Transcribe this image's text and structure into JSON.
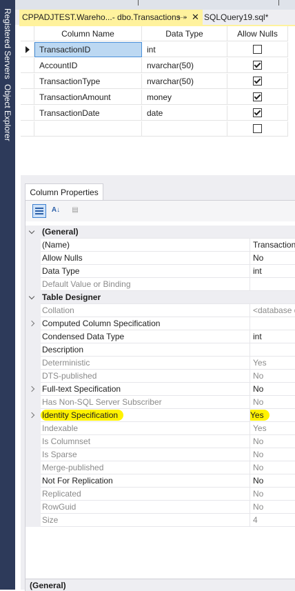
{
  "sidebar": {
    "registered_servers": "Registered Servers",
    "object_explorer": "Object Explorer"
  },
  "tabs": {
    "active": "CPPADJTEST.Wareho...- dbo.Transactions",
    "inactive": "SQLQuery19.sql*"
  },
  "grid": {
    "headers": {
      "name": "Column Name",
      "type": "Data Type",
      "nulls": "Allow Nulls"
    },
    "rows": [
      {
        "name": "TransactionID",
        "type": "int",
        "allow_nulls": false
      },
      {
        "name": "AccountID",
        "type": "nvarchar(50)",
        "allow_nulls": true
      },
      {
        "name": "TransactionType",
        "type": "nvarchar(50)",
        "allow_nulls": true
      },
      {
        "name": "TransactionAmount",
        "type": "money",
        "allow_nulls": true
      },
      {
        "name": "TransactionDate",
        "type": "date",
        "allow_nulls": true
      },
      {
        "name": "",
        "type": "",
        "allow_nulls": false
      }
    ]
  },
  "properties": {
    "tab_label": "Column Properties",
    "toolbar": {
      "alpha_label": "A↓"
    },
    "rows": [
      {
        "kind": "category",
        "name": "(General)"
      },
      {
        "name": "(Name)",
        "value": "TransactionID"
      },
      {
        "name": "Allow Nulls",
        "value": "No"
      },
      {
        "name": "Data Type",
        "value": "int"
      },
      {
        "name": "Default Value or Binding",
        "value": "",
        "gray": true
      },
      {
        "kind": "category",
        "name": "Table Designer"
      },
      {
        "name": "Collation",
        "value": "<database default>",
        "gray": true
      },
      {
        "name": "Computed Column Specification",
        "value": "",
        "expandable": true
      },
      {
        "name": "Condensed Data Type",
        "value": "int"
      },
      {
        "name": "Description",
        "value": ""
      },
      {
        "name": "Deterministic",
        "value": "Yes",
        "gray": true
      },
      {
        "name": "DTS-published",
        "value": "No",
        "gray": true
      },
      {
        "name": "Full-text Specification",
        "value": "No",
        "expandable": true
      },
      {
        "name": "Has Non-SQL Server Subscriber",
        "value": "No",
        "gray": true
      },
      {
        "name": "Identity Specification",
        "value": "Yes",
        "expandable": true,
        "highlighted": true
      },
      {
        "name": "Indexable",
        "value": "Yes",
        "gray": true
      },
      {
        "name": "Is Columnset",
        "value": "No",
        "gray": true
      },
      {
        "name": "Is Sparse",
        "value": "No",
        "gray": true
      },
      {
        "name": "Merge-published",
        "value": "No",
        "gray": true
      },
      {
        "name": "Not For Replication",
        "value": "No"
      },
      {
        "name": "Replicated",
        "value": "No",
        "gray": true
      },
      {
        "name": "RowGuid",
        "value": "No",
        "gray": true
      },
      {
        "name": "Size",
        "value": "4",
        "gray": true
      }
    ],
    "description_title": "(General)"
  },
  "colors": {
    "active_tab": "#fff29d",
    "sidebar": "#2d3a5a",
    "highlight": "#fff200",
    "selection": "#bcd8f2"
  }
}
